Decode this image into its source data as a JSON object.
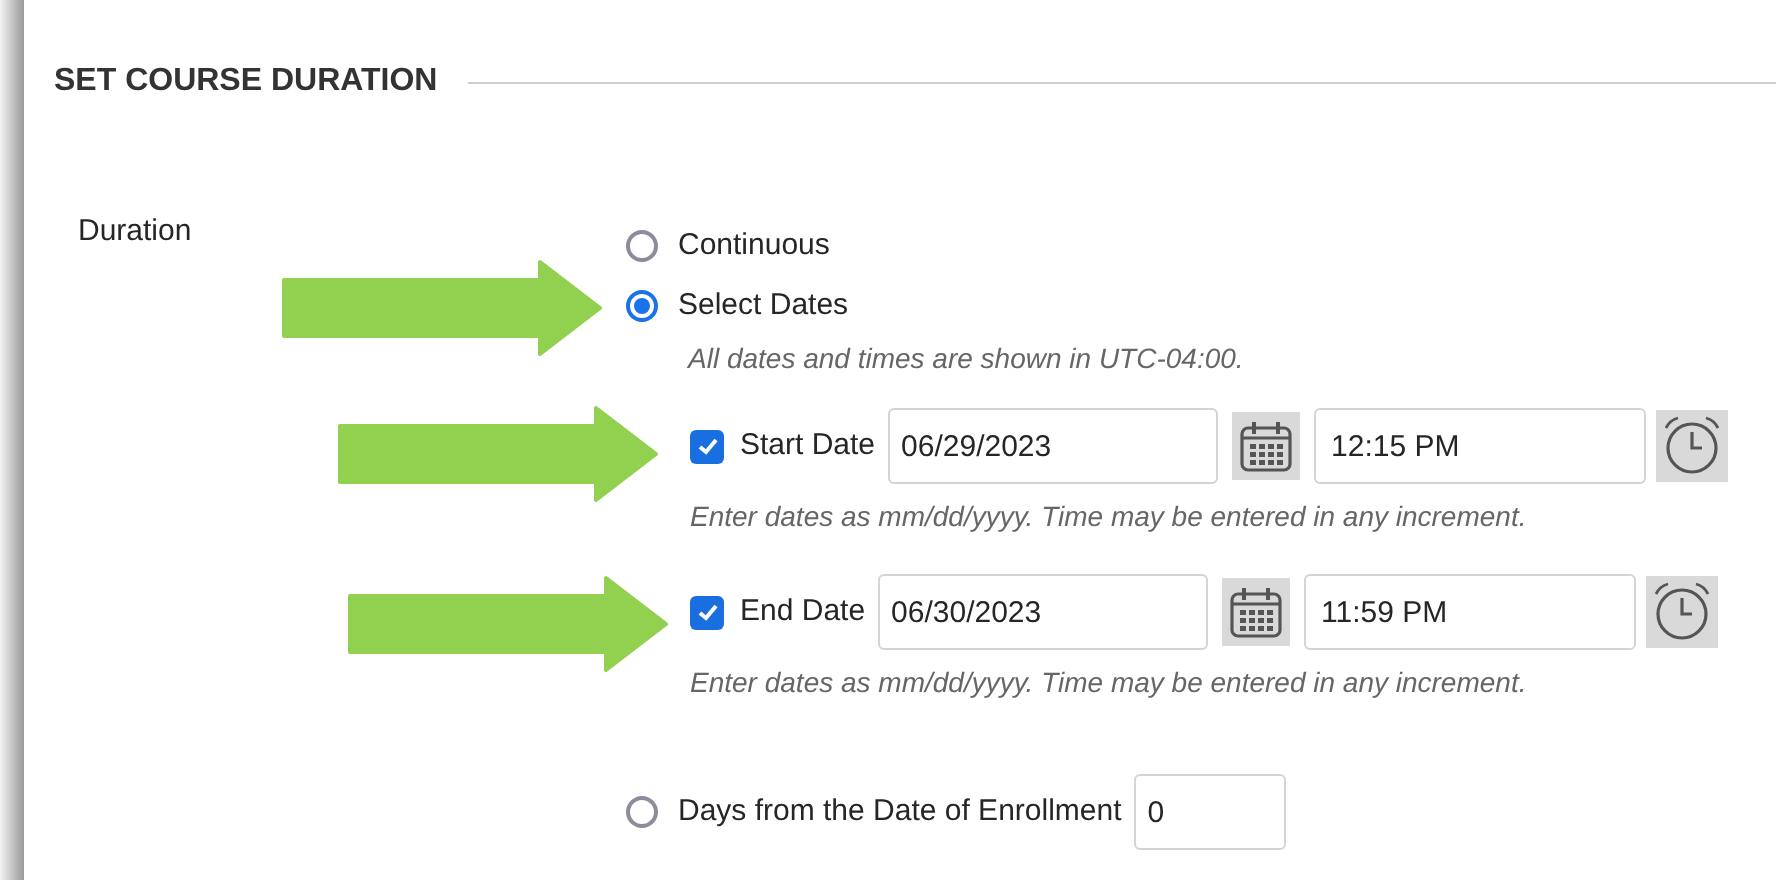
{
  "section": {
    "title": "SET COURSE DURATION"
  },
  "duration": {
    "label": "Duration",
    "options": [
      {
        "kind": "plain",
        "label": "Continuous",
        "selected": false
      },
      {
        "kind": "dates",
        "label": "Select Dates",
        "selected": true,
        "note": "All dates and times are shown in UTC-04:00.",
        "dates": [
          {
            "label": "Start Date",
            "checked": true,
            "date": "06/29/2023",
            "time": "12:15 PM",
            "hint": "Enter dates as mm/dd/yyyy. Time may be entered in any increment."
          },
          {
            "label": "End Date",
            "checked": true,
            "date": "06/30/2023",
            "time": "11:59 PM",
            "hint": "Enter dates as mm/dd/yyyy. Time may be entered in any increment."
          }
        ]
      },
      {
        "kind": "days",
        "label": "Days from the Date of Enrollment",
        "selected": false,
        "value": "0"
      }
    ]
  }
}
